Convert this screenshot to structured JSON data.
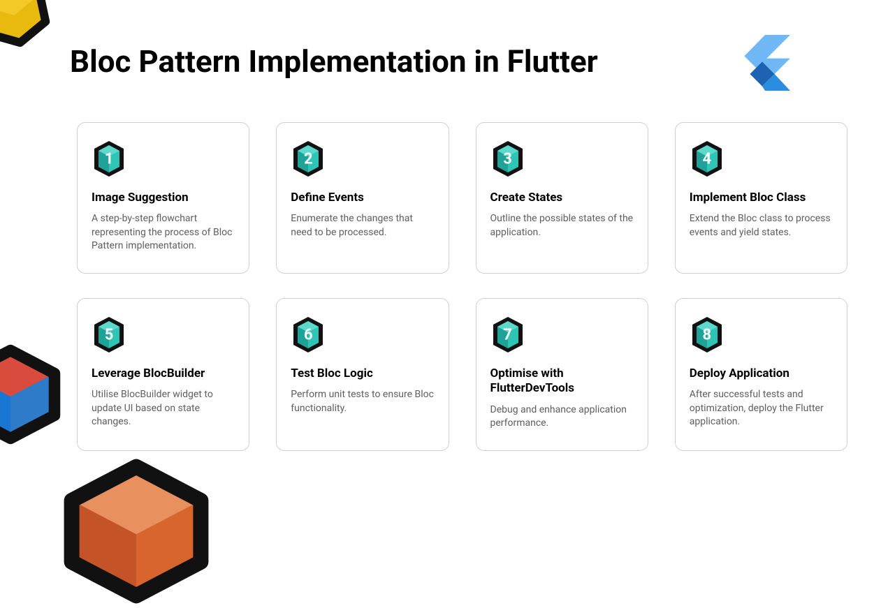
{
  "title": "Bloc Pattern Implementation in Flutter",
  "cards": [
    {
      "num": "1",
      "title": "Image Suggestion",
      "desc": "A step-by-step flowchart representing the process of Bloc Pattern implementation."
    },
    {
      "num": "2",
      "title": "Define Events",
      "desc": "Enumerate the changes that need to be processed."
    },
    {
      "num": "3",
      "title": "Create States",
      "desc": "Outline the possible states of the application."
    },
    {
      "num": "4",
      "title": "Implement Bloc Class",
      "desc": "Extend the Bloc class to process events and yield states."
    },
    {
      "num": "5",
      "title": "Leverage BlocBuilder",
      "desc": "Utilise BlocBuilder widget to update UI based on state changes."
    },
    {
      "num": "6",
      "title": "Test Bloc Logic",
      "desc": "Perform unit tests to ensure Bloc functionality."
    },
    {
      "num": "7",
      "title": "Optimise with FlutterDevTools",
      "desc": "Debug and enhance application performance."
    },
    {
      "num": "8",
      "title": "Deploy Application",
      "desc": "After successful tests and optimization, deploy the Flutter application."
    }
  ],
  "colors": {
    "hexOuter": "#111",
    "hexInner": "#2ec4b6",
    "numColor": "#fff"
  }
}
